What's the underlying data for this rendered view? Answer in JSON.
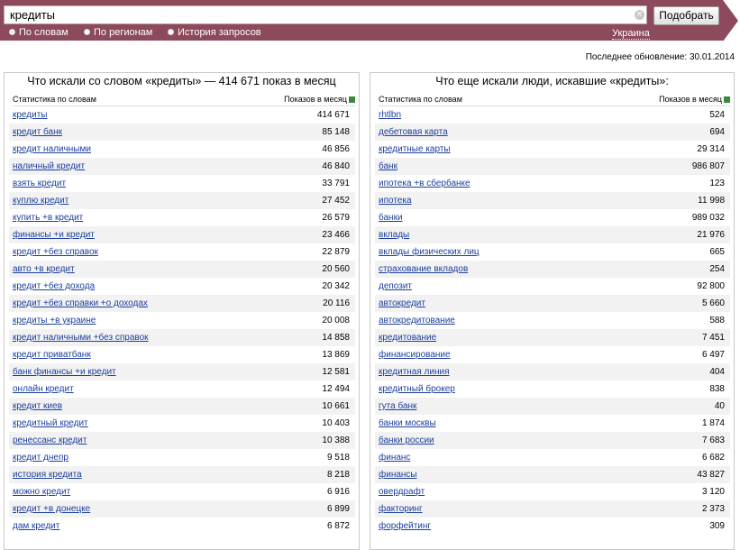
{
  "search": {
    "value": "кредиты",
    "button_label": "Подобрать"
  },
  "modes": [
    {
      "label": "По словам",
      "selected": true
    },
    {
      "label": "По регионам",
      "selected": false
    },
    {
      "label": "История запросов",
      "selected": false
    }
  ],
  "region": "Украина",
  "last_update": "Последнее обновление: 30.01.2014",
  "left_panel": {
    "title": "Что искали со словом «кредиты» — 414 671 показ в месяц",
    "col_left": "Статистика по словам",
    "col_right": "Показов в месяц",
    "rows": [
      [
        "кредиты",
        "414 671"
      ],
      [
        "кредит банк",
        "85 148"
      ],
      [
        "кредит наличными",
        "46 856"
      ],
      [
        "наличный кредит",
        "46 840"
      ],
      [
        "взять кредит",
        "33 791"
      ],
      [
        "куплю кредит",
        "27 452"
      ],
      [
        "купить +в кредит",
        "26 579"
      ],
      [
        "финансы +и кредит",
        "23 466"
      ],
      [
        "кредит +без справок",
        "22 879"
      ],
      [
        "авто +в кредит",
        "20 560"
      ],
      [
        "кредит +без дохода",
        "20 342"
      ],
      [
        "кредит +без справки +о доходах",
        "20 116"
      ],
      [
        "кредиты +в украине",
        "20 008"
      ],
      [
        "кредит наличными +без справок",
        "14 858"
      ],
      [
        "кредит приватбанк",
        "13 869"
      ],
      [
        "банк финансы +и кредит",
        "12 581"
      ],
      [
        "онлайн кредит",
        "12 494"
      ],
      [
        "кредит киев",
        "10 661"
      ],
      [
        "кредитный кредит",
        "10 403"
      ],
      [
        "ренессанс кредит",
        "10 388"
      ],
      [
        "кредит днепр",
        "9 518"
      ],
      [
        "история кредита",
        "8 218"
      ],
      [
        "можно кредит",
        "6 916"
      ],
      [
        "кредит +в донецке",
        "6 899"
      ],
      [
        "дам кредит",
        "6 872"
      ]
    ]
  },
  "right_panel": {
    "title": "Что еще искали люди, искавшие «кредиты»:",
    "col_left": "Статистика по словам",
    "col_right": "Показов в месяц",
    "rows": [
      [
        "rhtlbn",
        "524"
      ],
      [
        "дебетовая карта",
        "694"
      ],
      [
        "кредитные карты",
        "29 314"
      ],
      [
        "банк",
        "986 807"
      ],
      [
        "ипотека +в сбербанке",
        "123"
      ],
      [
        "ипотека",
        "11 998"
      ],
      [
        "банки",
        "989 032"
      ],
      [
        "вклады",
        "21 976"
      ],
      [
        "вклады физических лиц",
        "665"
      ],
      [
        "страхование вкладов",
        "254"
      ],
      [
        "депозит",
        "92 800"
      ],
      [
        "автокредит",
        "5 660"
      ],
      [
        "автокредитование",
        "588"
      ],
      [
        "кредитование",
        "7 451"
      ],
      [
        "финансирование",
        "6 497"
      ],
      [
        "кредитная линия",
        "404"
      ],
      [
        "кредитный брокер",
        "838"
      ],
      [
        "гута банк",
        "40"
      ],
      [
        "банки москвы",
        "1 874"
      ],
      [
        "банки россии",
        "7 683"
      ],
      [
        "финанс",
        "6 682"
      ],
      [
        "финансы",
        "43 827"
      ],
      [
        "овердрафт",
        "3 120"
      ],
      [
        "факторинг",
        "2 373"
      ],
      [
        "форфейтинг",
        "309"
      ]
    ]
  },
  "colors": {
    "bar": "#8c4a5c",
    "link": "#1c3f9c",
    "row_alt": "#f2f2f2"
  }
}
